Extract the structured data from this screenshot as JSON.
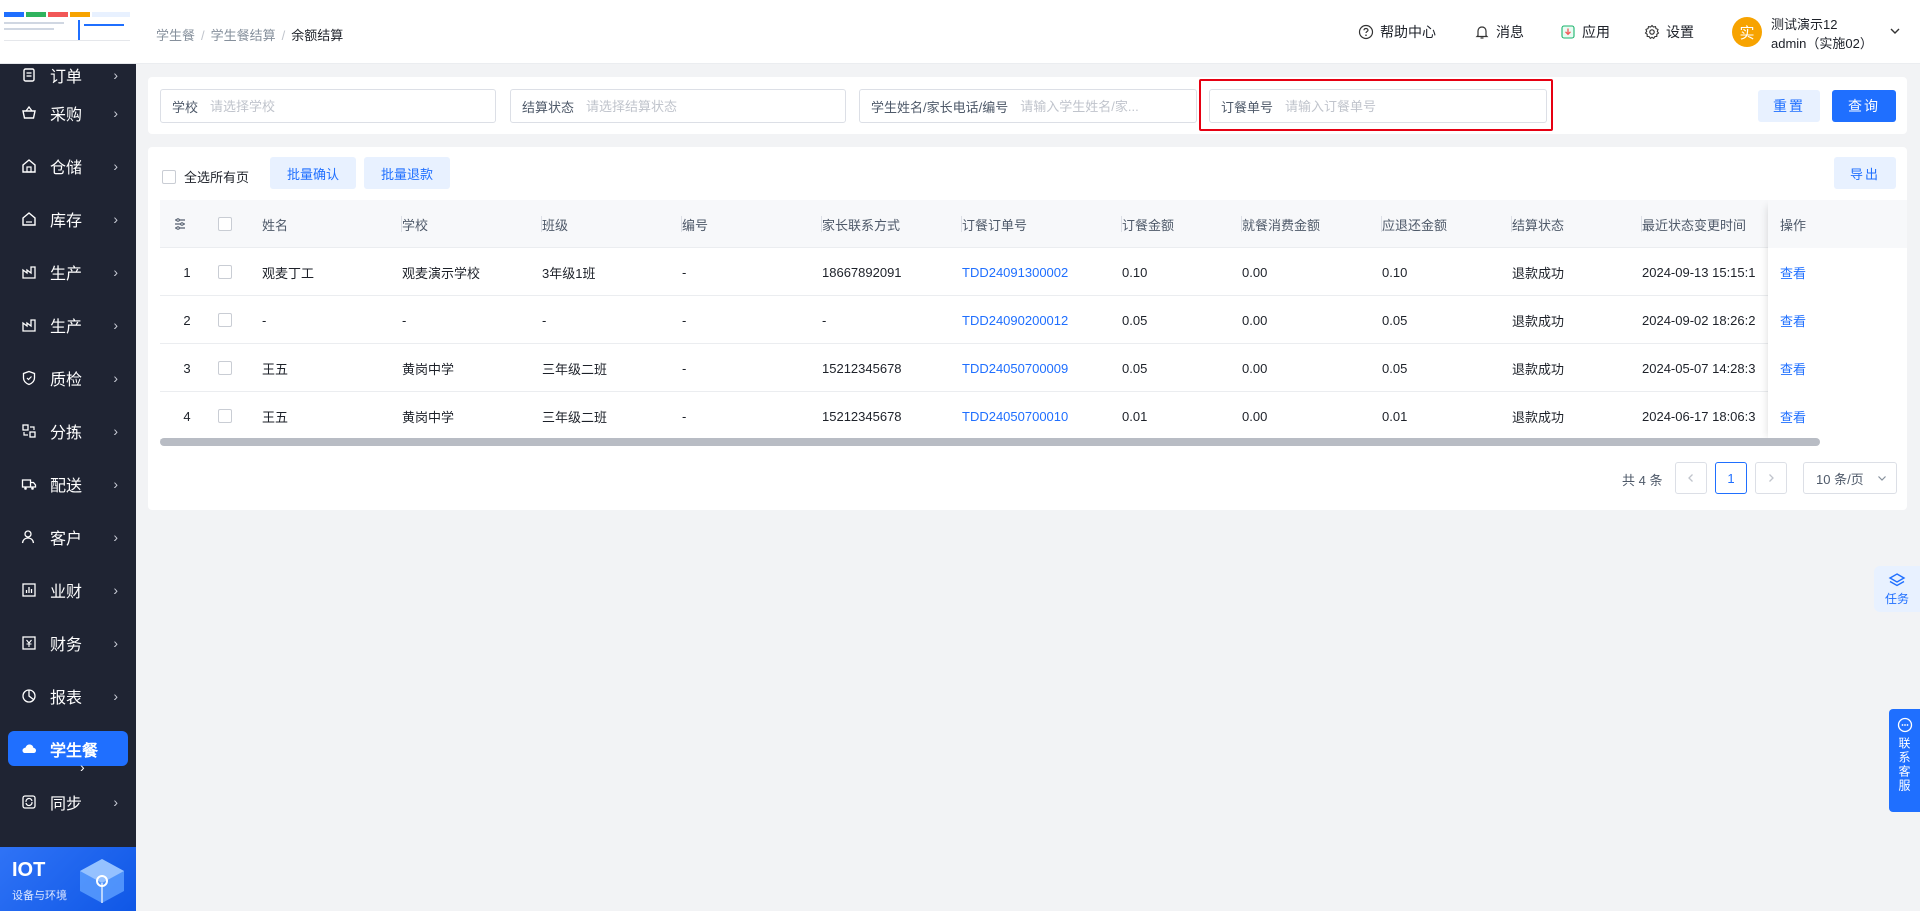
{
  "sidebar": {
    "items": [
      {
        "label": "订单",
        "icon": "order-icon"
      },
      {
        "label": "采购",
        "icon": "purchase-icon"
      },
      {
        "label": "仓储",
        "icon": "warehouse-icon"
      },
      {
        "label": "库存",
        "icon": "inventory-icon"
      },
      {
        "label": "生产",
        "icon": "production-icon"
      },
      {
        "label": "生产",
        "icon": "production-icon"
      },
      {
        "label": "质检",
        "icon": "quality-shield-icon"
      },
      {
        "label": "分拣",
        "icon": "sorting-icon"
      },
      {
        "label": "配送",
        "icon": "truck-icon"
      },
      {
        "label": "客户",
        "icon": "customer-icon"
      },
      {
        "label": "业财",
        "icon": "bar-chart-icon"
      },
      {
        "label": "财务",
        "icon": "finance-icon"
      },
      {
        "label": "报表",
        "icon": "report-pie-icon"
      },
      {
        "label": "学生餐",
        "icon": "cloud-meal-icon",
        "active": true
      },
      {
        "label": "同步",
        "icon": "sync-icon"
      }
    ],
    "iot": {
      "title": "IOT",
      "subtitle": "设备与环境"
    }
  },
  "header": {
    "breadcrumb": [
      "学生餐",
      "学生餐结算",
      "余额结算"
    ],
    "help": "帮助中心",
    "messages": "消息",
    "apps": "应用",
    "settings": "设置",
    "user": {
      "avatar_char": "实",
      "name": "测试演示12",
      "org": "admin（实施02）"
    }
  },
  "filters": {
    "school": {
      "label": "学校",
      "placeholder": "请选择学校"
    },
    "status": {
      "label": "结算状态",
      "placeholder": "请选择结算状态"
    },
    "student": {
      "label": "学生姓名/家长电话/编号",
      "placeholder": "请输入学生姓名/家..."
    },
    "order": {
      "label": "订餐单号",
      "placeholder": "请输入订餐单号"
    },
    "reset": "重置",
    "search": "查询"
  },
  "toolbar": {
    "select_all": "全选所有页",
    "batch_confirm": "批量确认",
    "batch_refund": "批量退款",
    "export": "导出"
  },
  "table": {
    "columns": [
      "姓名",
      "学校",
      "班级",
      "编号",
      "家长联系方式",
      "订餐订单号",
      "订餐金额",
      "就餐消费金额",
      "应退还金额",
      "结算状态",
      "最近状态变更时间",
      "操作"
    ],
    "rows": [
      {
        "idx": "1",
        "name": "观麦丁工",
        "school": "观麦演示学校",
        "cls": "3年级1班",
        "code": "-",
        "phone": "18667892091",
        "order": "TDD24091300002",
        "amount": "0.10",
        "consumed": "0.00",
        "refund": "0.10",
        "status": "退款成功",
        "time": "2024-09-13 15:15:1",
        "op": "查看"
      },
      {
        "idx": "2",
        "name": "-",
        "school": "-",
        "cls": "-",
        "code": "-",
        "phone": "-",
        "order": "TDD24090200012",
        "amount": "0.05",
        "consumed": "0.00",
        "refund": "0.05",
        "status": "退款成功",
        "time": "2024-09-02 18:26:2",
        "op": "查看"
      },
      {
        "idx": "3",
        "name": "王五",
        "school": "黄岗中学",
        "cls": "三年级二班",
        "code": "-",
        "phone": "15212345678",
        "order": "TDD24050700009",
        "amount": "0.05",
        "consumed": "0.00",
        "refund": "0.05",
        "status": "退款成功",
        "time": "2024-05-07 14:28:3",
        "op": "查看"
      },
      {
        "idx": "4",
        "name": "王五",
        "school": "黄岗中学",
        "cls": "三年级二班",
        "code": "-",
        "phone": "15212345678",
        "order": "TDD24050700010",
        "amount": "0.01",
        "consumed": "0.00",
        "refund": "0.01",
        "status": "退款成功",
        "time": "2024-06-17 18:06:3",
        "op": "查看"
      }
    ]
  },
  "pagination": {
    "total": "共 4 条",
    "current": "1",
    "page_size": "10 条/页"
  },
  "floats": {
    "task": "任务",
    "service": "联系客服"
  },
  "colors": {
    "primary": "#1f6fff",
    "sidebar_bg": "#1f2433",
    "highlight": "#e60012",
    "avatar": "#f7a300"
  }
}
